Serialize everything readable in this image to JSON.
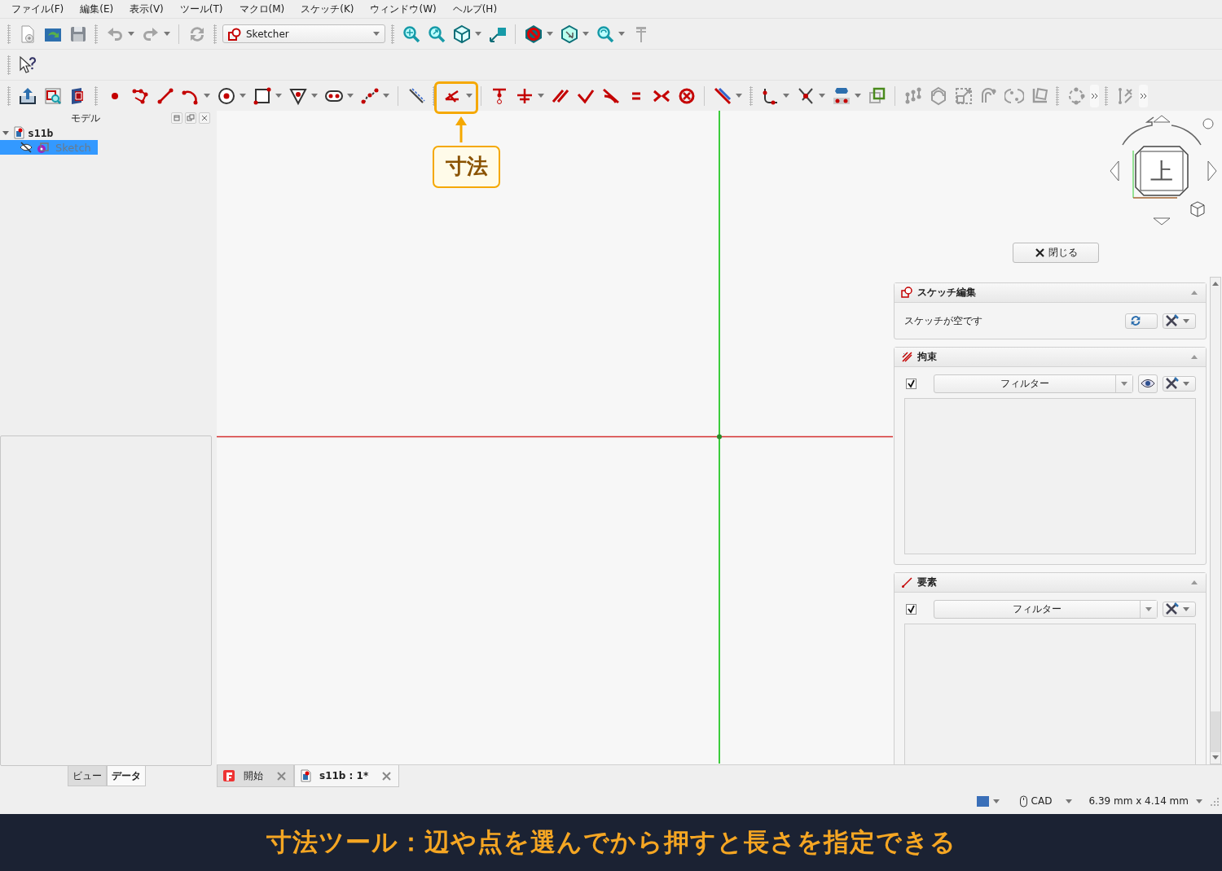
{
  "menu": [
    {
      "label": "ファイル(F)"
    },
    {
      "label": "編集(E)"
    },
    {
      "label": "表示(V)"
    },
    {
      "label": "ツール(T)"
    },
    {
      "label": "マクロ(M)"
    },
    {
      "label": "スケッチ(K)"
    },
    {
      "label": "ウィンドウ(W)"
    },
    {
      "label": "ヘルプ(H)"
    }
  ],
  "workbench": {
    "value": "Sketcher"
  },
  "model_panel": {
    "title": "モデル",
    "tree": [
      {
        "label": "s11b",
        "expanded": true,
        "selected": false,
        "children": [
          {
            "label": "Sketch",
            "selected": true
          }
        ]
      }
    ]
  },
  "property_tabs": [
    {
      "label": "ビュー",
      "selected": false
    },
    {
      "label": "データ",
      "selected": true
    }
  ],
  "navigation_cube": {
    "face": "上"
  },
  "close_button": {
    "label": "閉じる"
  },
  "sections": [
    {
      "kind": "edit",
      "title": "スケッチ編集",
      "expanded": true,
      "message": "スケッチが空です"
    },
    {
      "kind": "constraints",
      "title": "拘束",
      "expanded": true,
      "checked": true,
      "filter": "フィルター"
    },
    {
      "kind": "elements",
      "title": "要素",
      "expanded": true,
      "checked": true,
      "filter": "フィルター"
    }
  ],
  "document_tabs": [
    {
      "label": "開始",
      "selected": false
    },
    {
      "label": "s11b : 1*",
      "selected": true
    }
  ],
  "status_bar": {
    "navigation": "CAD",
    "dimensions": "6.39 mm x 4.14 mm"
  },
  "callout": {
    "label": "寸法"
  },
  "caption": "寸法ツール：辺や点を選んでから押すと長さを指定できる"
}
